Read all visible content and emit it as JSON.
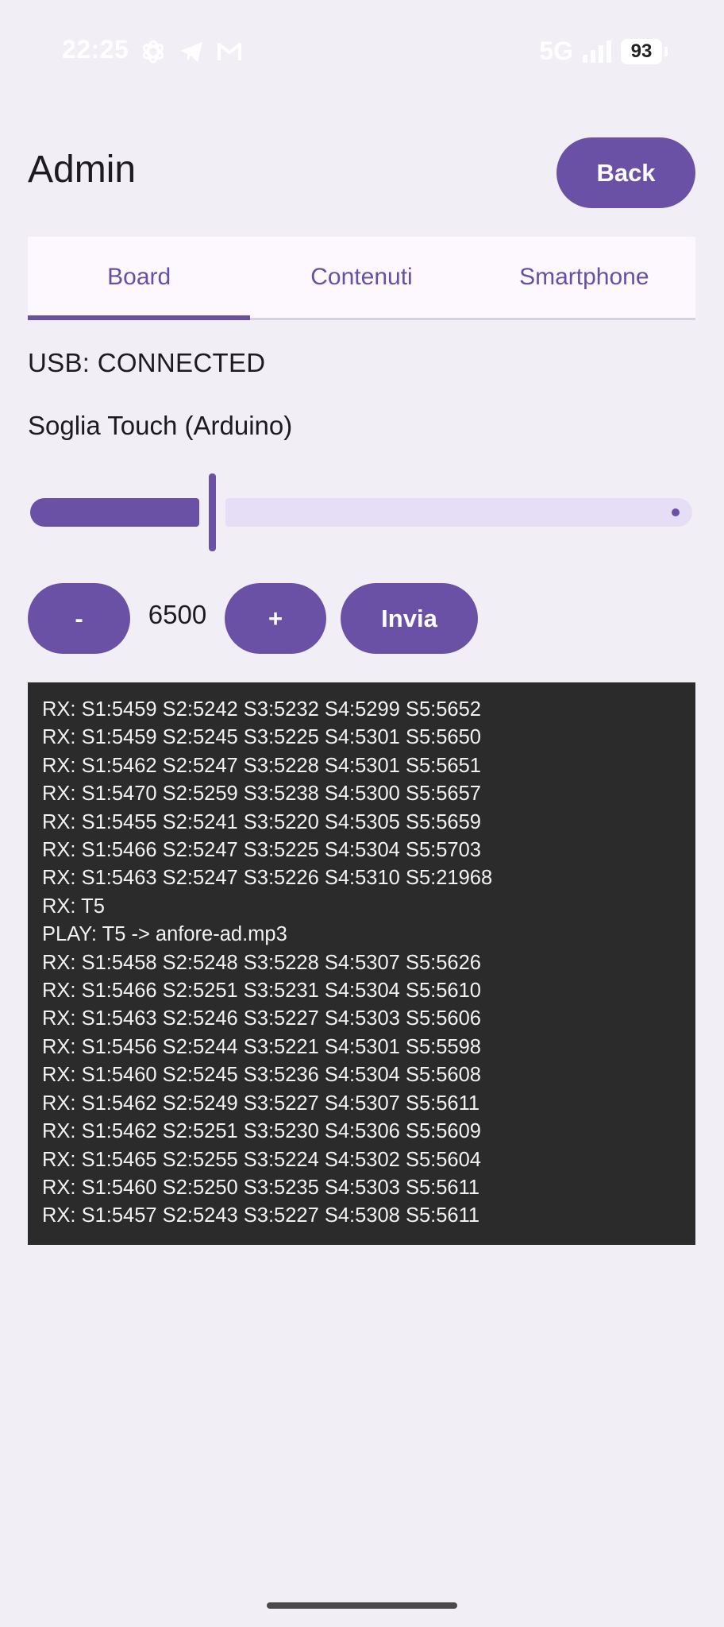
{
  "status_bar": {
    "time": "22:25",
    "icons_left": [
      "openai-icon",
      "telegram-icon",
      "gmail-icon"
    ],
    "network": "5G",
    "battery": "93"
  },
  "header": {
    "title": "Admin",
    "back_label": "Back"
  },
  "tabs": [
    {
      "label": "Board",
      "active": true
    },
    {
      "label": "Contenuti",
      "active": false
    },
    {
      "label": "Smartphone",
      "active": false
    }
  ],
  "usb_status": "USB: CONNECTED",
  "slider": {
    "label": "Soglia Touch (Arduino)",
    "fraction": 0.27
  },
  "controls": {
    "minus_label": "-",
    "value": "6500",
    "plus_label": "+",
    "send_label": "Invia"
  },
  "log": [
    "RX: S1:5459 S2:5242 S3:5232 S4:5299 S5:5652",
    "RX: S1:5459 S2:5245 S3:5225 S4:5301 S5:5650",
    "RX: S1:5462 S2:5247 S3:5228 S4:5301 S5:5651",
    "RX: S1:5470 S2:5259 S3:5238 S4:5300 S5:5657",
    "RX: S1:5455 S2:5241 S3:5220 S4:5305 S5:5659",
    "RX: S1:5466 S2:5247 S3:5225 S4:5304 S5:5703",
    "RX: S1:5463 S2:5247 S3:5226 S4:5310 S5:21968",
    "RX: T5",
    "PLAY: T5 -> anfore-ad.mp3",
    "RX: S1:5458 S2:5248 S3:5228 S4:5307 S5:5626",
    "RX: S1:5466 S2:5251 S3:5231 S4:5304 S5:5610",
    "RX: S1:5463 S2:5246 S3:5227 S4:5303 S5:5606",
    "RX: S1:5456 S2:5244 S3:5221 S4:5301 S5:5598",
    "RX: S1:5460 S2:5245 S3:5236 S4:5304 S5:5608",
    "RX: S1:5462 S2:5249 S3:5227 S4:5307 S5:5611",
    "RX: S1:5462 S2:5251 S3:5230 S4:5306 S5:5609",
    "RX: S1:5465 S2:5255 S3:5224 S4:5302 S5:5604",
    "RX: S1:5460 S2:5250 S3:5235 S4:5303 S5:5611",
    "RX: S1:5457 S2:5243 S3:5227 S4:5308 S5:5611"
  ],
  "colors": {
    "primary": "#6b51a6",
    "background": "#f1eef6",
    "log_background": "#2b2b2b"
  }
}
